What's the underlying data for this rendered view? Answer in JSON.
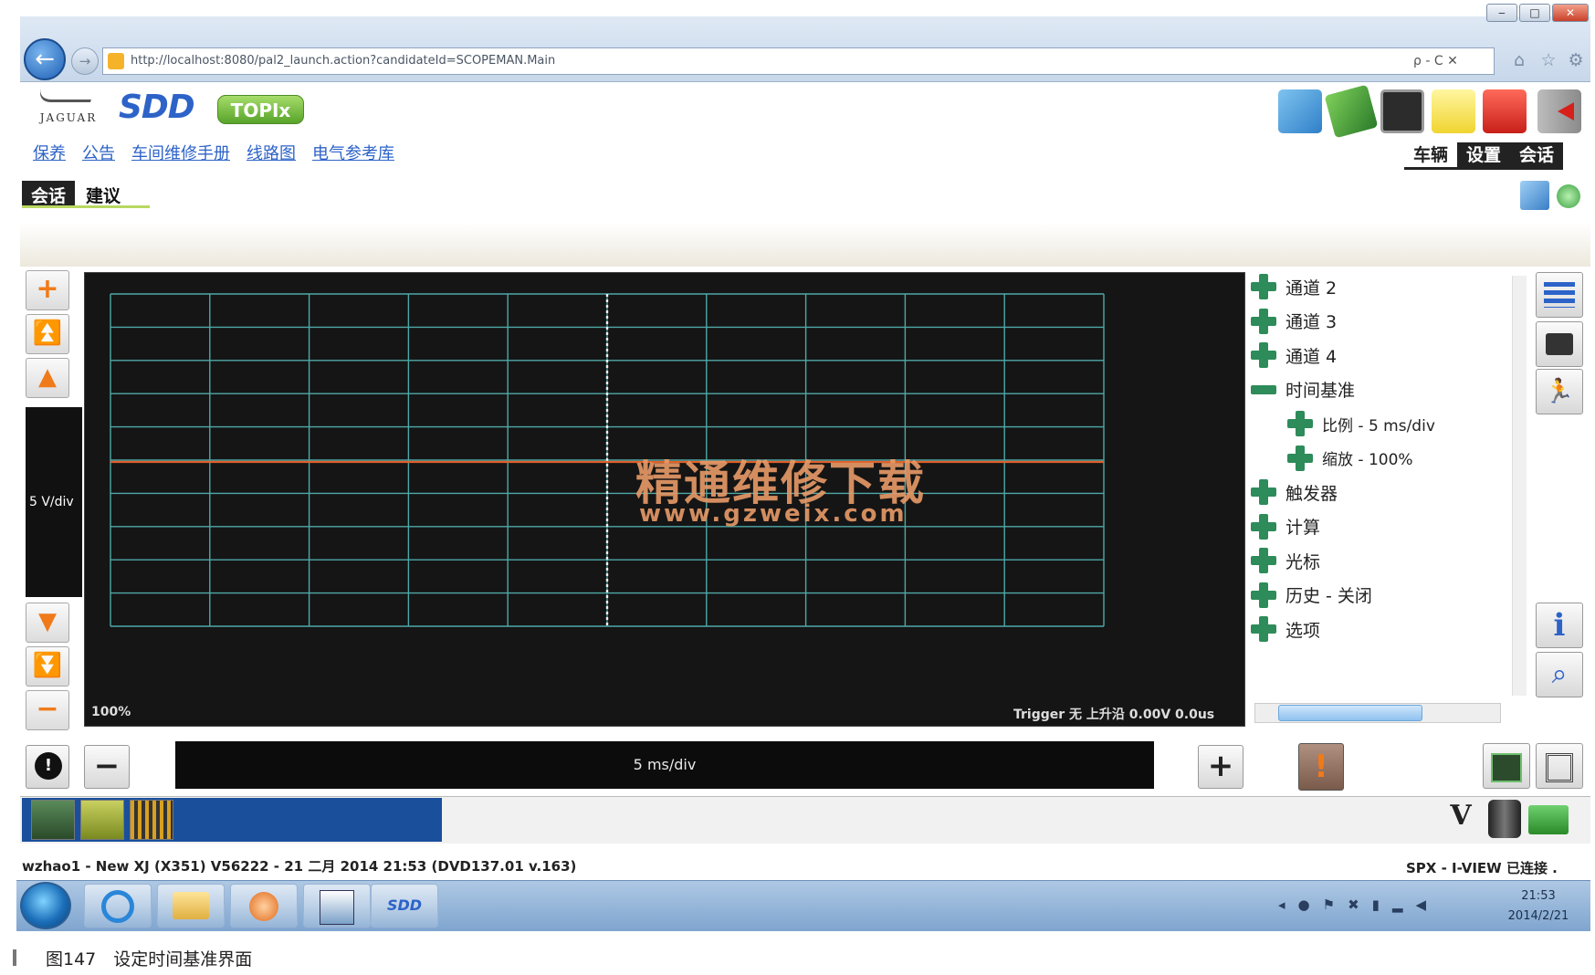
{
  "browser": {
    "url": "http://localhost:8080/pal2_launch.action?candidateId=SCOPEMAN.Main",
    "addr_tools": "ρ - C ✕",
    "window_controls": [
      "‒",
      "□",
      "✕"
    ],
    "toolbar_icons": [
      "home-icon",
      "star-icon",
      "gear-icon"
    ]
  },
  "app": {
    "brand": "JAGUAR",
    "product": "SDD",
    "topix": "TOPIx",
    "nav_links": [
      "保养",
      "公告",
      "车间维修手册",
      "线路图",
      "电气参考库"
    ],
    "header_tabs": [
      "车辆",
      "设置",
      "会话"
    ],
    "session_tabs": [
      "会话",
      "建议"
    ]
  },
  "scope": {
    "volts_per_div": "5 V/div",
    "zoom": "100%",
    "trigger": "Trigger 无 上升沿 0.00V 0.0us",
    "timebase": "5 ms/div",
    "watermark_line1": "精通维修下载",
    "watermark_line2": "www.gzweix.com",
    "trace_color": "#e0602a",
    "grid_color": "#4fa8a8"
  },
  "tree": {
    "items": [
      {
        "label": "通道 2",
        "state": "collapsed"
      },
      {
        "label": "通道 3",
        "state": "collapsed"
      },
      {
        "label": "通道 4",
        "state": "collapsed"
      },
      {
        "label": "时间基准",
        "state": "expanded"
      },
      {
        "label": "比例 - 5 ms/div",
        "state": "collapsed",
        "child": true
      },
      {
        "label": "缩放 - 100%",
        "state": "collapsed",
        "child": true
      },
      {
        "label": "触发器",
        "state": "collapsed"
      },
      {
        "label": "计算",
        "state": "collapsed"
      },
      {
        "label": "光标",
        "state": "collapsed"
      },
      {
        "label": "历史 - 关闭",
        "state": "collapsed"
      },
      {
        "label": "选项",
        "state": "collapsed"
      }
    ]
  },
  "status": {
    "left": "wzhao1 - New XJ (X351) V56222 - 21 二月 2014 21:53 (DVD137.01 v.163)",
    "right": "SPX - I-VIEW 已连接 ."
  },
  "taskbar": {
    "sdd_label": "SDD",
    "time": "21:53",
    "date": "2014/2/21"
  },
  "caption": "图147　设定时间基准界面"
}
